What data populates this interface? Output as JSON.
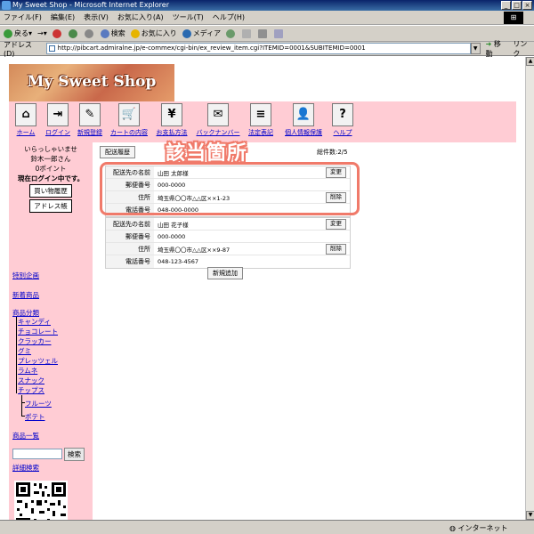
{
  "window": {
    "title": "My Sweet Shop - Microsoft Internet Explorer",
    "min": "_",
    "max": "□",
    "close": "×"
  },
  "menubar": [
    "ファイル(F)",
    "編集(E)",
    "表示(V)",
    "お気に入り(A)",
    "ツール(T)",
    "ヘルプ(H)"
  ],
  "toolbar": {
    "back": "戻る",
    "forward": "→",
    "search": "検索",
    "favorites": "お気に入り",
    "media": "メディア"
  },
  "address": {
    "label": "アドレス(D)",
    "url": "http://pibcart.admiralne.jp/e-commex/cgi-bin/ex_review_item.cgi?ITEMID=0001&SUBITEMID=0001",
    "go": "移動",
    "links": "リンク"
  },
  "status": {
    "zone": "インターネット"
  },
  "shop": {
    "logo": "My Sweet Shop",
    "nav": [
      {
        "label": "ホーム",
        "icon": "⌂"
      },
      {
        "label": "ログイン",
        "icon": "⇥"
      },
      {
        "label": "新規登録",
        "icon": "✎"
      },
      {
        "label": "カートの内容",
        "icon": "🛒"
      },
      {
        "label": "お支払方法",
        "icon": "¥"
      },
      {
        "label": "バックナンバー",
        "icon": "✉"
      },
      {
        "label": "法定表記",
        "icon": "≡"
      },
      {
        "label": "個人情報保護",
        "icon": "👤"
      },
      {
        "label": "ヘルプ",
        "icon": "?"
      }
    ]
  },
  "sidebar": {
    "greeting": "いらっしゃいませ",
    "user": "鈴木一郎さん",
    "points": "0ポイント",
    "login_status": "現在ログイン中です。",
    "history_btn": "買い物履歴",
    "address_btn": "アドレス帳",
    "special": "特別企画",
    "new": "新着商品",
    "category": "商品分類",
    "categories": [
      "キャンディ",
      "チョコレート",
      "クラッカー",
      "グミ",
      "プレッツェル",
      "ラムネ",
      "スナック",
      "チップス"
    ],
    "sub": [
      "フルーツ",
      "ポテト"
    ],
    "product_list": "商品一覧",
    "search_btn": "検索",
    "advanced": "詳細検索"
  },
  "main": {
    "history_btn": "配送履歴",
    "total": "総件数:2/5",
    "annotation": "該当箇所",
    "labels": {
      "name": "配送先の名前",
      "zip": "郵便番号",
      "address": "住所",
      "phone": "電話番号"
    },
    "edit": "変更",
    "delete": "削除",
    "add": "新規追加",
    "entries": [
      {
        "name": "山田 太郎様",
        "zip": "000-0000",
        "address": "埼玉県〇〇市△△区××1-23",
        "phone": "048-000-0000"
      },
      {
        "name": "山田 花子様",
        "zip": "000-0000",
        "address": "埼玉県〇〇市△△区××9-87",
        "phone": "048-123-4567"
      }
    ]
  }
}
